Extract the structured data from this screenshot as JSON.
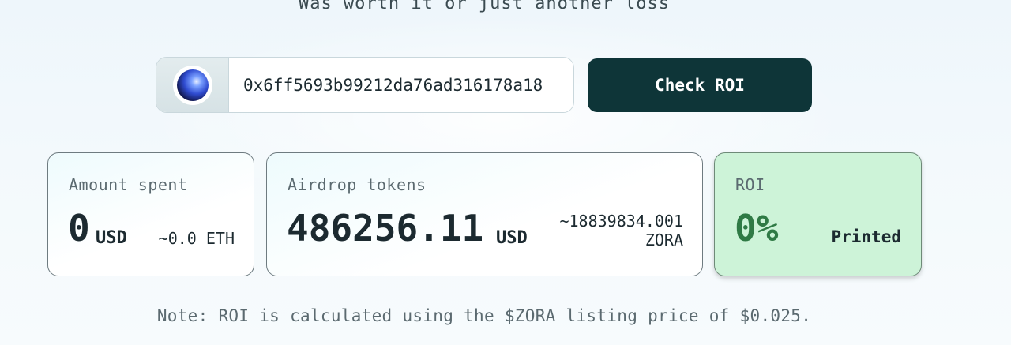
{
  "header": {
    "subtitle": "Was worth it or just another loss"
  },
  "search": {
    "address": "0x6ff5693b99212da76ad316178a18",
    "button_label": "Check ROI"
  },
  "cards": {
    "spent": {
      "label": "Amount spent",
      "value": "0",
      "unit": "USD",
      "sub": "~0.0 ETH"
    },
    "airdrop": {
      "label": "Airdrop tokens",
      "value": "486256.11",
      "unit": "USD",
      "sub_amount": "~18839834.001",
      "sub_token": "ZORA"
    },
    "roi": {
      "label": "ROI",
      "value": "0%",
      "status": "Printed"
    }
  },
  "note": "Note: ROI is calculated using the $ZORA listing price of $0.025.",
  "colors": {
    "button_bg": "#0e3538",
    "roi_card_bg": "#cdf3d8",
    "roi_value": "#2f7a45"
  }
}
